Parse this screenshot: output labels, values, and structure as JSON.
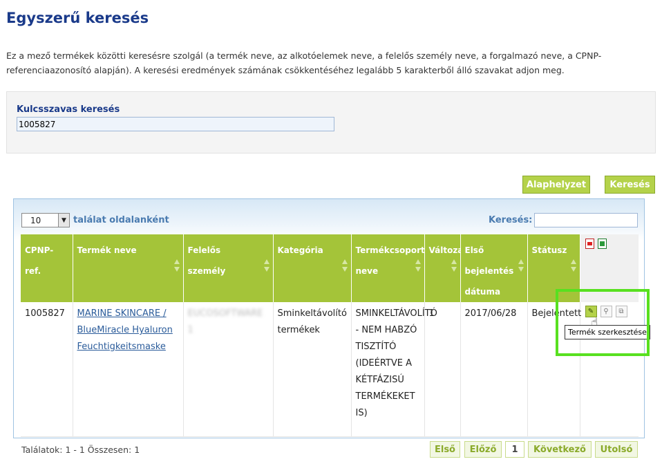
{
  "page": {
    "title": "Egyszerű keresés",
    "intro": "Ez a mező termékek közötti keresésre szolgál (a termék neve, az alkotóelemek neve, a felelős személy neve, a forgalmazó neve, a CPNP-referenciaazonosító alapján). A keresési eredmények számának csökkentéséhez legalább 5 karakterből álló szavakat adjon meg."
  },
  "search": {
    "label": "Kulcsszavas keresés",
    "value": "1005827",
    "reset_label": "Alaphelyzet",
    "submit_label": "Keresés"
  },
  "table_controls": {
    "page_length": "10",
    "page_length_label": "találat oldalanként",
    "filter_label": "Keresés:",
    "filter_value": ""
  },
  "columns": [
    {
      "label": "CPNP-ref."
    },
    {
      "label": "Termék neve"
    },
    {
      "label": "Felelős személy"
    },
    {
      "label": "Kategória"
    },
    {
      "label": "Termékcsoport neve"
    },
    {
      "label": "Változat"
    },
    {
      "label": "Első bejelentés dátuma"
    },
    {
      "label": "Státusz"
    }
  ],
  "export": {
    "pdf_icon": "pdf-icon",
    "excel_icon": "excel-icon"
  },
  "rows": [
    {
      "cpnp_ref": "1005827",
      "product_name": "MARINE SKINCARE / BlueMiracle Hyaluron Feuchtigkeitsmaske",
      "responsible_person": "EUCOSOFTWARE 1",
      "category": "Sminkeltávolító termékek",
      "product_group": "SMINKELTÁVOLÍTÓ - NEM HABZÓ TISZTÍTÓ (IDEÉRTVE A KÉTFÁZISÚ TERMÉKEKET IS)",
      "variant": "1",
      "first_notification": "2017/06/28",
      "status": "Bejelentett"
    }
  ],
  "row_actions": {
    "edit_icon": "pencil-icon",
    "view_icon": "magnifier-icon",
    "copy_icon": "copy-icon",
    "tooltip": "Termék szerkesztése"
  },
  "footer": {
    "info": "Találatok: 1 - 1 Összesen: 1",
    "first": "Első",
    "prev": "Előző",
    "current_page": "1",
    "next": "Következő",
    "last": "Utolsó"
  },
  "colors": {
    "accent_green": "#a4c439",
    "title_blue": "#1a3a8a",
    "highlight": "#58e020"
  }
}
